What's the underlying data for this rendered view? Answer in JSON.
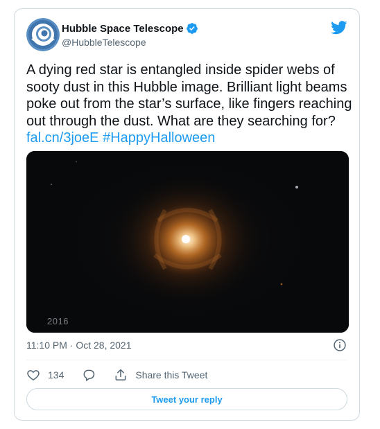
{
  "author": {
    "name": "Hubble Space Telescope",
    "handle": "@HubbleTelescope",
    "verified": true
  },
  "tweet": {
    "text": "A dying red star is entangled inside spider webs of sooty dust in this Hubble image. Brilliant light beams poke out from the star’s surface, like fingers reaching out through the dust. What are they searching for? ",
    "link": "fal.cn/3joeE",
    "hashtag": "#HappyHalloween"
  },
  "media": {
    "year_label": "2016"
  },
  "meta": {
    "timestamp": "11:10 PM · Oct 28, 2021"
  },
  "actions": {
    "like_count": "134",
    "share_label": "Share this Tweet"
  },
  "reply_button": {
    "label": "Tweet your reply"
  },
  "colors": {
    "accent": "#1d9bf0",
    "text": "#0f1419",
    "secondary": "#536471",
    "border": "#cfd9de"
  },
  "icons": [
    "hubble-logo-avatar",
    "verified-badge-icon",
    "twitter-bird-icon",
    "info-icon",
    "heart-icon",
    "reply-bubble-icon",
    "share-icon"
  ]
}
